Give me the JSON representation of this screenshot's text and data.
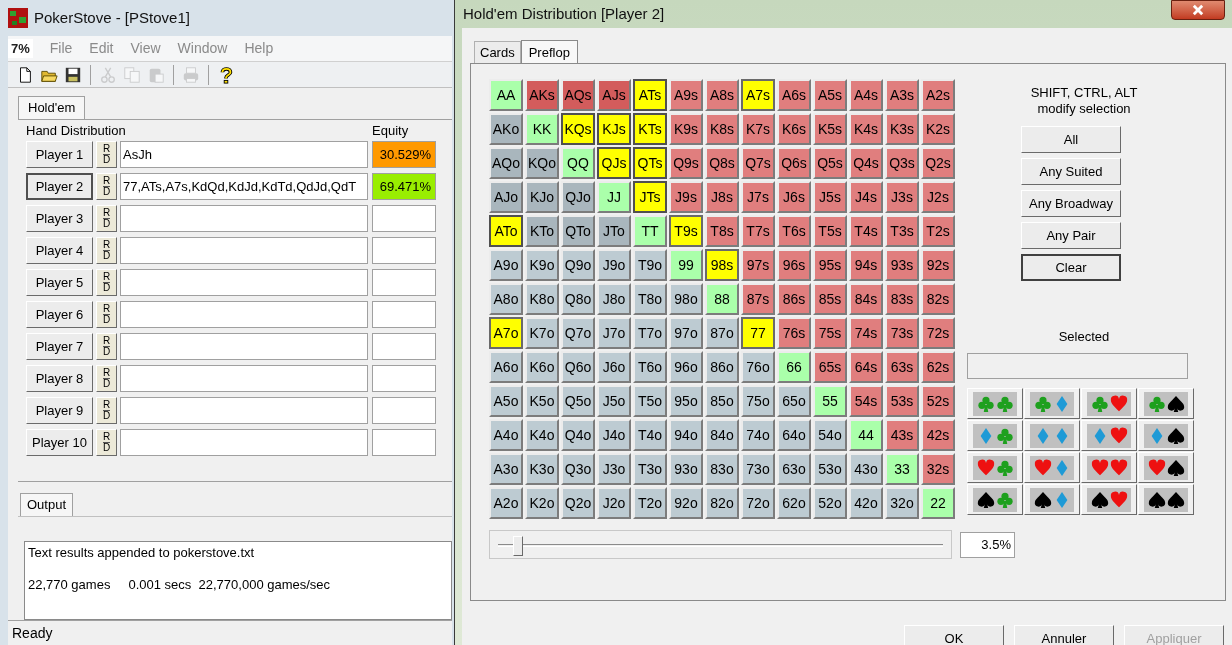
{
  "main_window": {
    "title": "PokerStove - [PStove1]",
    "menu": {
      "doc_icon": "7%",
      "items": [
        "File",
        "Edit",
        "View",
        "Window",
        "Help"
      ]
    },
    "toolbar": [
      {
        "kind": "new",
        "disabled": false
      },
      {
        "kind": "open",
        "disabled": false
      },
      {
        "kind": "save",
        "disabled": false
      },
      {
        "kind": "separator"
      },
      {
        "kind": "cut",
        "disabled": true
      },
      {
        "kind": "copy",
        "disabled": true
      },
      {
        "kind": "paste",
        "disabled": true
      },
      {
        "kind": "separator"
      },
      {
        "kind": "print",
        "disabled": true
      },
      {
        "kind": "separator"
      },
      {
        "kind": "help",
        "disabled": false
      }
    ],
    "tab": "Hold'em",
    "headers": {
      "distribution": "Hand Distribution",
      "equity": "Equity"
    },
    "players": [
      {
        "button": "Player 1",
        "rd": [
          "R",
          "D"
        ],
        "hand": "AsJh",
        "equity": "30.529%",
        "color": "#ff9900",
        "selected": false
      },
      {
        "button": "Player 2",
        "rd": [
          "R",
          "D"
        ],
        "hand": "77,ATs,A7s,KdQd,KdJd,KdTd,QdJd,QdT",
        "equity": "69.471%",
        "color": "#99ee00",
        "selected": true
      },
      {
        "button": "Player 3",
        "rd": [
          "R",
          "D"
        ],
        "selected": false
      },
      {
        "button": "Player 4",
        "rd": [
          "R",
          "D"
        ],
        "selected": false
      },
      {
        "button": "Player 5",
        "rd": [
          "R",
          "D"
        ],
        "selected": false
      },
      {
        "button": "Player 6",
        "rd": [
          "R",
          "D"
        ],
        "selected": false
      },
      {
        "button": "Player 7",
        "rd": [
          "R",
          "D"
        ],
        "selected": false
      },
      {
        "button": "Player 8",
        "rd": [
          "R",
          "D"
        ],
        "selected": false
      },
      {
        "button": "Player 9",
        "rd": [
          "R",
          "D"
        ],
        "selected": false
      },
      {
        "button": "Player 10",
        "rd": [
          "R",
          "D"
        ],
        "selected": false
      }
    ],
    "output_tab": "Output",
    "output_lines": [
      "Text results appended to pokerstove.txt",
      "22,770 games     0.001 secs  22,770,000 games/sec"
    ],
    "status_bar": "Ready"
  },
  "dialog": {
    "title": "Hold'em Distribution [Player 2]",
    "tabs": [
      {
        "label": "Cards",
        "selected": false
      },
      {
        "label": "Preflop",
        "selected": true
      }
    ],
    "range_grid": [
      [
        {
          "label": "AA",
          "kind": "pair",
          "selected": false,
          "broadway": false
        },
        {
          "label": "AKs",
          "kind": "suited",
          "selected": false,
          "broadway": true
        },
        {
          "label": "AQs",
          "kind": "suited",
          "selected": false,
          "broadway": true
        },
        {
          "label": "AJs",
          "kind": "suited",
          "selected": false,
          "broadway": true
        },
        {
          "label": "ATs",
          "kind": "suited",
          "selected": true,
          "broadway": true
        },
        {
          "label": "A9s",
          "kind": "suited",
          "selected": false,
          "broadway": false
        },
        {
          "label": "A8s",
          "kind": "suited",
          "selected": false,
          "broadway": false
        },
        {
          "label": "A7s",
          "kind": "suited",
          "selected": true,
          "broadway": false
        },
        {
          "label": "A6s",
          "kind": "suited",
          "selected": false,
          "broadway": false
        },
        {
          "label": "A5s",
          "kind": "suited",
          "selected": false,
          "broadway": false
        },
        {
          "label": "A4s",
          "kind": "suited",
          "selected": false,
          "broadway": false
        },
        {
          "label": "A3s",
          "kind": "suited",
          "selected": false,
          "broadway": false
        },
        {
          "label": "A2s",
          "kind": "suited",
          "selected": false,
          "broadway": false
        }
      ],
      [
        {
          "label": "AKo",
          "kind": "offsuit",
          "selected": false,
          "broadway": true
        },
        {
          "label": "KK",
          "kind": "pair",
          "selected": false,
          "broadway": false
        },
        {
          "label": "KQs",
          "kind": "suited",
          "selected": true,
          "broadway": true
        },
        {
          "label": "KJs",
          "kind": "suited",
          "selected": true,
          "broadway": true
        },
        {
          "label": "KTs",
          "kind": "suited",
          "selected": true,
          "broadway": true
        },
        {
          "label": "K9s",
          "kind": "suited",
          "selected": false,
          "broadway": false
        },
        {
          "label": "K8s",
          "kind": "suited",
          "selected": false,
          "broadway": false
        },
        {
          "label": "K7s",
          "kind": "suited",
          "selected": false,
          "broadway": false
        },
        {
          "label": "K6s",
          "kind": "suited",
          "selected": false,
          "broadway": false
        },
        {
          "label": "K5s",
          "kind": "suited",
          "selected": false,
          "broadway": false
        },
        {
          "label": "K4s",
          "kind": "suited",
          "selected": false,
          "broadway": false
        },
        {
          "label": "K3s",
          "kind": "suited",
          "selected": false,
          "broadway": false
        },
        {
          "label": "K2s",
          "kind": "suited",
          "selected": false,
          "broadway": false
        }
      ],
      [
        {
          "label": "AQo",
          "kind": "offsuit",
          "selected": false,
          "broadway": true
        },
        {
          "label": "KQo",
          "kind": "offsuit",
          "selected": false,
          "broadway": true
        },
        {
          "label": "QQ",
          "kind": "pair",
          "selected": false,
          "broadway": false
        },
        {
          "label": "QJs",
          "kind": "suited",
          "selected": true,
          "broadway": true
        },
        {
          "label": "QTs",
          "kind": "suited",
          "selected": true,
          "broadway": true
        },
        {
          "label": "Q9s",
          "kind": "suited",
          "selected": false,
          "broadway": false
        },
        {
          "label": "Q8s",
          "kind": "suited",
          "selected": false,
          "broadway": false
        },
        {
          "label": "Q7s",
          "kind": "suited",
          "selected": false,
          "broadway": false
        },
        {
          "label": "Q6s",
          "kind": "suited",
          "selected": false,
          "broadway": false
        },
        {
          "label": "Q5s",
          "kind": "suited",
          "selected": false,
          "broadway": false
        },
        {
          "label": "Q4s",
          "kind": "suited",
          "selected": false,
          "broadway": false
        },
        {
          "label": "Q3s",
          "kind": "suited",
          "selected": false,
          "broadway": false
        },
        {
          "label": "Q2s",
          "kind": "suited",
          "selected": false,
          "broadway": false
        }
      ],
      [
        {
          "label": "AJo",
          "kind": "offsuit",
          "selected": false,
          "broadway": true
        },
        {
          "label": "KJo",
          "kind": "offsuit",
          "selected": false,
          "broadway": true
        },
        {
          "label": "QJo",
          "kind": "offsuit",
          "selected": false,
          "broadway": true
        },
        {
          "label": "JJ",
          "kind": "pair",
          "selected": false,
          "broadway": false
        },
        {
          "label": "JTs",
          "kind": "suited",
          "selected": true,
          "broadway": true
        },
        {
          "label": "J9s",
          "kind": "suited",
          "selected": false,
          "broadway": false
        },
        {
          "label": "J8s",
          "kind": "suited",
          "selected": false,
          "broadway": false
        },
        {
          "label": "J7s",
          "kind": "suited",
          "selected": false,
          "broadway": false
        },
        {
          "label": "J6s",
          "kind": "suited",
          "selected": false,
          "broadway": false
        },
        {
          "label": "J5s",
          "kind": "suited",
          "selected": false,
          "broadway": false
        },
        {
          "label": "J4s",
          "kind": "suited",
          "selected": false,
          "broadway": false
        },
        {
          "label": "J3s",
          "kind": "suited",
          "selected": false,
          "broadway": false
        },
        {
          "label": "J2s",
          "kind": "suited",
          "selected": false,
          "broadway": false
        }
      ],
      [
        {
          "label": "ATo",
          "kind": "offsuit",
          "selected": true,
          "broadway": true
        },
        {
          "label": "KTo",
          "kind": "offsuit",
          "selected": false,
          "broadway": true
        },
        {
          "label": "QTo",
          "kind": "offsuit",
          "selected": false,
          "broadway": true
        },
        {
          "label": "JTo",
          "kind": "offsuit",
          "selected": false,
          "broadway": true
        },
        {
          "label": "TT",
          "kind": "pair",
          "selected": false,
          "broadway": false
        },
        {
          "label": "T9s",
          "kind": "suited",
          "selected": true,
          "broadway": false
        },
        {
          "label": "T8s",
          "kind": "suited",
          "selected": false,
          "broadway": false
        },
        {
          "label": "T7s",
          "kind": "suited",
          "selected": false,
          "broadway": false
        },
        {
          "label": "T6s",
          "kind": "suited",
          "selected": false,
          "broadway": false
        },
        {
          "label": "T5s",
          "kind": "suited",
          "selected": false,
          "broadway": false
        },
        {
          "label": "T4s",
          "kind": "suited",
          "selected": false,
          "broadway": false
        },
        {
          "label": "T3s",
          "kind": "suited",
          "selected": false,
          "broadway": false
        },
        {
          "label": "T2s",
          "kind": "suited",
          "selected": false,
          "broadway": false
        }
      ],
      [
        {
          "label": "A9o",
          "kind": "offsuit",
          "selected": false,
          "broadway": false
        },
        {
          "label": "K9o",
          "kind": "offsuit",
          "selected": false,
          "broadway": false
        },
        {
          "label": "Q9o",
          "kind": "offsuit",
          "selected": false,
          "broadway": false
        },
        {
          "label": "J9o",
          "kind": "offsuit",
          "selected": false,
          "broadway": false
        },
        {
          "label": "T9o",
          "kind": "offsuit",
          "selected": false,
          "broadway": false
        },
        {
          "label": "99",
          "kind": "pair",
          "selected": false,
          "broadway": false
        },
        {
          "label": "98s",
          "kind": "suited",
          "selected": true,
          "broadway": false
        },
        {
          "label": "97s",
          "kind": "suited",
          "selected": false,
          "broadway": false
        },
        {
          "label": "96s",
          "kind": "suited",
          "selected": false,
          "broadway": false
        },
        {
          "label": "95s",
          "kind": "suited",
          "selected": false,
          "broadway": false
        },
        {
          "label": "94s",
          "kind": "suited",
          "selected": false,
          "broadway": false
        },
        {
          "label": "93s",
          "kind": "suited",
          "selected": false,
          "broadway": false
        },
        {
          "label": "92s",
          "kind": "suited",
          "selected": false,
          "broadway": false
        }
      ],
      [
        {
          "label": "A8o",
          "kind": "offsuit",
          "selected": false,
          "broadway": false
        },
        {
          "label": "K8o",
          "kind": "offsuit",
          "selected": false,
          "broadway": false
        },
        {
          "label": "Q8o",
          "kind": "offsuit",
          "selected": false,
          "broadway": false
        },
        {
          "label": "J8o",
          "kind": "offsuit",
          "selected": false,
          "broadway": false
        },
        {
          "label": "T8o",
          "kind": "offsuit",
          "selected": false,
          "broadway": false
        },
        {
          "label": "98o",
          "kind": "offsuit",
          "selected": false,
          "broadway": false
        },
        {
          "label": "88",
          "kind": "pair",
          "selected": false,
          "broadway": false
        },
        {
          "label": "87s",
          "kind": "suited",
          "selected": false,
          "broadway": false
        },
        {
          "label": "86s",
          "kind": "suited",
          "selected": false,
          "broadway": false
        },
        {
          "label": "85s",
          "kind": "suited",
          "selected": false,
          "broadway": false
        },
        {
          "label": "84s",
          "kind": "suited",
          "selected": false,
          "broadway": false
        },
        {
          "label": "83s",
          "kind": "suited",
          "selected": false,
          "broadway": false
        },
        {
          "label": "82s",
          "kind": "suited",
          "selected": false,
          "broadway": false
        }
      ],
      [
        {
          "label": "A7o",
          "kind": "offsuit",
          "selected": true,
          "broadway": false
        },
        {
          "label": "K7o",
          "kind": "offsuit",
          "selected": false,
          "broadway": false
        },
        {
          "label": "Q7o",
          "kind": "offsuit",
          "selected": false,
          "broadway": false
        },
        {
          "label": "J7o",
          "kind": "offsuit",
          "selected": false,
          "broadway": false
        },
        {
          "label": "T7o",
          "kind": "offsuit",
          "selected": false,
          "broadway": false
        },
        {
          "label": "97o",
          "kind": "offsuit",
          "selected": false,
          "broadway": false
        },
        {
          "label": "87o",
          "kind": "offsuit",
          "selected": false,
          "broadway": false
        },
        {
          "label": "77",
          "kind": "pair",
          "selected": true,
          "broadway": false
        },
        {
          "label": "76s",
          "kind": "suited",
          "selected": false,
          "broadway": false
        },
        {
          "label": "75s",
          "kind": "suited",
          "selected": false,
          "broadway": false
        },
        {
          "label": "74s",
          "kind": "suited",
          "selected": false,
          "broadway": false
        },
        {
          "label": "73s",
          "kind": "suited",
          "selected": false,
          "broadway": false
        },
        {
          "label": "72s",
          "kind": "suited",
          "selected": false,
          "broadway": false
        }
      ],
      [
        {
          "label": "A6o",
          "kind": "offsuit",
          "selected": false,
          "broadway": false
        },
        {
          "label": "K6o",
          "kind": "offsuit",
          "selected": false,
          "broadway": false
        },
        {
          "label": "Q6o",
          "kind": "offsuit",
          "selected": false,
          "broadway": false
        },
        {
          "label": "J6o",
          "kind": "offsuit",
          "selected": false,
          "broadway": false
        },
        {
          "label": "T6o",
          "kind": "offsuit",
          "selected": false,
          "broadway": false
        },
        {
          "label": "96o",
          "kind": "offsuit",
          "selected": false,
          "broadway": false
        },
        {
          "label": "86o",
          "kind": "offsuit",
          "selected": false,
          "broadway": false
        },
        {
          "label": "76o",
          "kind": "offsuit",
          "selected": false,
          "broadway": false
        },
        {
          "label": "66",
          "kind": "pair",
          "selected": false,
          "broadway": false
        },
        {
          "label": "65s",
          "kind": "suited",
          "selected": false,
          "broadway": false
        },
        {
          "label": "64s",
          "kind": "suited",
          "selected": false,
          "broadway": false
        },
        {
          "label": "63s",
          "kind": "suited",
          "selected": false,
          "broadway": false
        },
        {
          "label": "62s",
          "kind": "suited",
          "selected": false,
          "broadway": false
        }
      ],
      [
        {
          "label": "A5o",
          "kind": "offsuit",
          "selected": false,
          "broadway": false
        },
        {
          "label": "K5o",
          "kind": "offsuit",
          "selected": false,
          "broadway": false
        },
        {
          "label": "Q5o",
          "kind": "offsuit",
          "selected": false,
          "broadway": false
        },
        {
          "label": "J5o",
          "kind": "offsuit",
          "selected": false,
          "broadway": false
        },
        {
          "label": "T5o",
          "kind": "offsuit",
          "selected": false,
          "broadway": false
        },
        {
          "label": "95o",
          "kind": "offsuit",
          "selected": false,
          "broadway": false
        },
        {
          "label": "85o",
          "kind": "offsuit",
          "selected": false,
          "broadway": false
        },
        {
          "label": "75o",
          "kind": "offsuit",
          "selected": false,
          "broadway": false
        },
        {
          "label": "65o",
          "kind": "offsuit",
          "selected": false,
          "broadway": false
        },
        {
          "label": "55",
          "kind": "pair",
          "selected": false,
          "broadway": false
        },
        {
          "label": "54s",
          "kind": "suited",
          "selected": false,
          "broadway": false
        },
        {
          "label": "53s",
          "kind": "suited",
          "selected": false,
          "broadway": false
        },
        {
          "label": "52s",
          "kind": "suited",
          "selected": false,
          "broadway": false
        }
      ],
      [
        {
          "label": "A4o",
          "kind": "offsuit",
          "selected": false,
          "broadway": false
        },
        {
          "label": "K4o",
          "kind": "offsuit",
          "selected": false,
          "broadway": false
        },
        {
          "label": "Q4o",
          "kind": "offsuit",
          "selected": false,
          "broadway": false
        },
        {
          "label": "J4o",
          "kind": "offsuit",
          "selected": false,
          "broadway": false
        },
        {
          "label": "T4o",
          "kind": "offsuit",
          "selected": false,
          "broadway": false
        },
        {
          "label": "94o",
          "kind": "offsuit",
          "selected": false,
          "broadway": false
        },
        {
          "label": "84o",
          "kind": "offsuit",
          "selected": false,
          "broadway": false
        },
        {
          "label": "74o",
          "kind": "offsuit",
          "selected": false,
          "broadway": false
        },
        {
          "label": "64o",
          "kind": "offsuit",
          "selected": false,
          "broadway": false
        },
        {
          "label": "54o",
          "kind": "offsuit",
          "selected": false,
          "broadway": false
        },
        {
          "label": "44",
          "kind": "pair",
          "selected": false,
          "broadway": false
        },
        {
          "label": "43s",
          "kind": "suited",
          "selected": false,
          "broadway": false
        },
        {
          "label": "42s",
          "kind": "suited",
          "selected": false,
          "broadway": false
        }
      ],
      [
        {
          "label": "A3o",
          "kind": "offsuit",
          "selected": false,
          "broadway": false
        },
        {
          "label": "K3o",
          "kind": "offsuit",
          "selected": false,
          "broadway": false
        },
        {
          "label": "Q3o",
          "kind": "offsuit",
          "selected": false,
          "broadway": false
        },
        {
          "label": "J3o",
          "kind": "offsuit",
          "selected": false,
          "broadway": false
        },
        {
          "label": "T3o",
          "kind": "offsuit",
          "selected": false,
          "broadway": false
        },
        {
          "label": "93o",
          "kind": "offsuit",
          "selected": false,
          "broadway": false
        },
        {
          "label": "83o",
          "kind": "offsuit",
          "selected": false,
          "broadway": false
        },
        {
          "label": "73o",
          "kind": "offsuit",
          "selected": false,
          "broadway": false
        },
        {
          "label": "63o",
          "kind": "offsuit",
          "selected": false,
          "broadway": false
        },
        {
          "label": "53o",
          "kind": "offsuit",
          "selected": false,
          "broadway": false
        },
        {
          "label": "43o",
          "kind": "offsuit",
          "selected": false,
          "broadway": false
        },
        {
          "label": "33",
          "kind": "pair",
          "selected": false,
          "broadway": false
        },
        {
          "label": "32s",
          "kind": "suited",
          "selected": false,
          "broadway": false
        }
      ],
      [
        {
          "label": "A2o",
          "kind": "offsuit",
          "selected": false,
          "broadway": false
        },
        {
          "label": "K2o",
          "kind": "offsuit",
          "selected": false,
          "broadway": false
        },
        {
          "label": "Q2o",
          "kind": "offsuit",
          "selected": false,
          "broadway": false
        },
        {
          "label": "J2o",
          "kind": "offsuit",
          "selected": false,
          "broadway": false
        },
        {
          "label": "T2o",
          "kind": "offsuit",
          "selected": false,
          "broadway": false
        },
        {
          "label": "92o",
          "kind": "offsuit",
          "selected": false,
          "broadway": false
        },
        {
          "label": "82o",
          "kind": "offsuit",
          "selected": false,
          "broadway": false
        },
        {
          "label": "72o",
          "kind": "offsuit",
          "selected": false,
          "broadway": false
        },
        {
          "label": "62o",
          "kind": "offsuit",
          "selected": false,
          "broadway": false
        },
        {
          "label": "52o",
          "kind": "offsuit",
          "selected": false,
          "broadway": false
        },
        {
          "label": "42o",
          "kind": "offsuit",
          "selected": false,
          "broadway": false
        },
        {
          "label": "32o",
          "kind": "offsuit",
          "selected": false,
          "broadway": false
        },
        {
          "label": "22",
          "kind": "pair",
          "selected": false,
          "broadway": false
        }
      ]
    ],
    "hint": [
      "SHIFT, CTRL, ALT",
      "modify selection"
    ],
    "buttons": [
      {
        "label": "All",
        "default": false
      },
      {
        "label": "Any Suited",
        "default": false
      },
      {
        "label": "Any Broadway",
        "default": false
      },
      {
        "label": "Any Pair",
        "default": false
      },
      {
        "label": "Clear",
        "default": true
      }
    ],
    "selected_label": "Selected",
    "suit_combos": [
      {
        "suits": [
          {
            "kind": "club"
          },
          {
            "kind": "club"
          }
        ]
      },
      {
        "suits": [
          {
            "kind": "club"
          },
          {
            "kind": "diamond"
          }
        ]
      },
      {
        "suits": [
          {
            "kind": "club"
          },
          {
            "kind": "heart"
          }
        ]
      },
      {
        "suits": [
          {
            "kind": "club"
          },
          {
            "kind": "spade"
          }
        ]
      },
      {
        "suits": [
          {
            "kind": "diamond"
          },
          {
            "kind": "club"
          }
        ]
      },
      {
        "suits": [
          {
            "kind": "diamond"
          },
          {
            "kind": "diamond"
          }
        ]
      },
      {
        "suits": [
          {
            "kind": "diamond"
          },
          {
            "kind": "heart"
          }
        ]
      },
      {
        "suits": [
          {
            "kind": "diamond"
          },
          {
            "kind": "spade"
          }
        ]
      },
      {
        "suits": [
          {
            "kind": "heart"
          },
          {
            "kind": "club"
          }
        ]
      },
      {
        "suits": [
          {
            "kind": "heart"
          },
          {
            "kind": "diamond"
          }
        ]
      },
      {
        "suits": [
          {
            "kind": "heart"
          },
          {
            "kind": "heart"
          }
        ]
      },
      {
        "suits": [
          {
            "kind": "heart"
          },
          {
            "kind": "spade"
          }
        ]
      },
      {
        "suits": [
          {
            "kind": "spade"
          },
          {
            "kind": "club"
          }
        ]
      },
      {
        "suits": [
          {
            "kind": "spade"
          },
          {
            "kind": "diamond"
          }
        ]
      },
      {
        "suits": [
          {
            "kind": "spade"
          },
          {
            "kind": "heart"
          }
        ]
      },
      {
        "suits": [
          {
            "kind": "spade"
          },
          {
            "kind": "spade"
          }
        ]
      }
    ],
    "slider": {
      "level": 0.035,
      "value": "3.5%"
    },
    "footer_buttons": [
      {
        "label": "OK",
        "disabled": false
      },
      {
        "label": "Annuler",
        "disabled": false
      },
      {
        "label": "Appliquer",
        "disabled": true
      }
    ]
  }
}
